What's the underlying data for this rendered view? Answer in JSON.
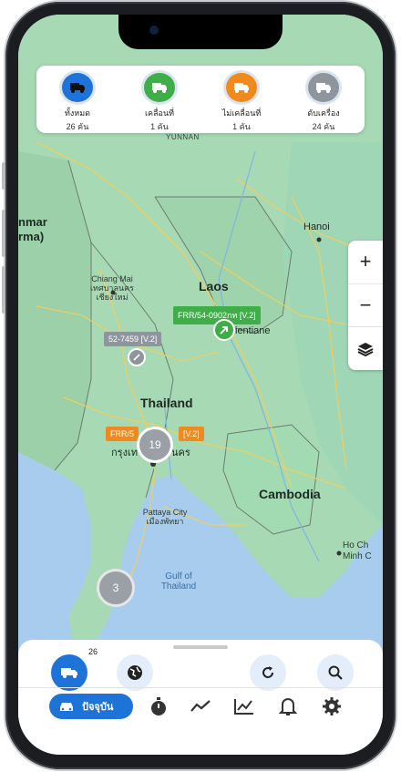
{
  "status": [
    {
      "label": "ทั้งหมด",
      "count": "26 คัน",
      "color": "#1e73d8",
      "icon": "truck-icon"
    },
    {
      "label": "เคลื่อนที่",
      "count": "1 คัน",
      "color": "#3fae49",
      "icon": "truck-moving-icon"
    },
    {
      "label": "ไม่เคลื่อนที่",
      "count": "1 คัน",
      "color": "#f08a1c",
      "icon": "truck-stopped-icon"
    },
    {
      "label": "ดับเครื่อง",
      "count": "24 คัน",
      "color": "#8e959c",
      "icon": "truck-off-icon"
    }
  ],
  "map": {
    "labels": {
      "yunnan": "YUNNAN",
      "hanoi": "Hanoi",
      "laos": "Laos",
      "thailand": "Thailand",
      "cambodia": "Cambodia",
      "myanmar": "nmar",
      "myanmar2": "rma)",
      "chiangmai": "Chiang Mai\nเทศบาลนคร\nเชียงใหม่",
      "vientiane": "ientiane",
      "bangkok": "กรุงเท",
      "bangkok2": "นคร",
      "pattaya": "Pattaya City\nเมืองพัทยา",
      "gulf": "Gulf of\nThailand",
      "hochiminh": "Ho Ch\nMinh C"
    },
    "controls": {
      "zoom_in": "+",
      "zoom_out": "−"
    },
    "vehicles": [
      {
        "label": "FRR/54-0902กท [V.2]",
        "color": "#3fae49"
      },
      {
        "label": "52-7459 [V.2]",
        "color": "#8e959c"
      },
      {
        "label": "FRR/5",
        "label_tail": "[V.2]",
        "color": "#f08a1c"
      }
    ],
    "clusters": [
      {
        "count": "19"
      },
      {
        "count": "3"
      }
    ]
  },
  "bottom": {
    "vehicle_badge": "26",
    "nav_current": "ปัจจุบัน"
  },
  "colors": {
    "accent": "#1e73d8",
    "map_land": "#a8d8c0",
    "map_sea": "#a8ccee"
  }
}
